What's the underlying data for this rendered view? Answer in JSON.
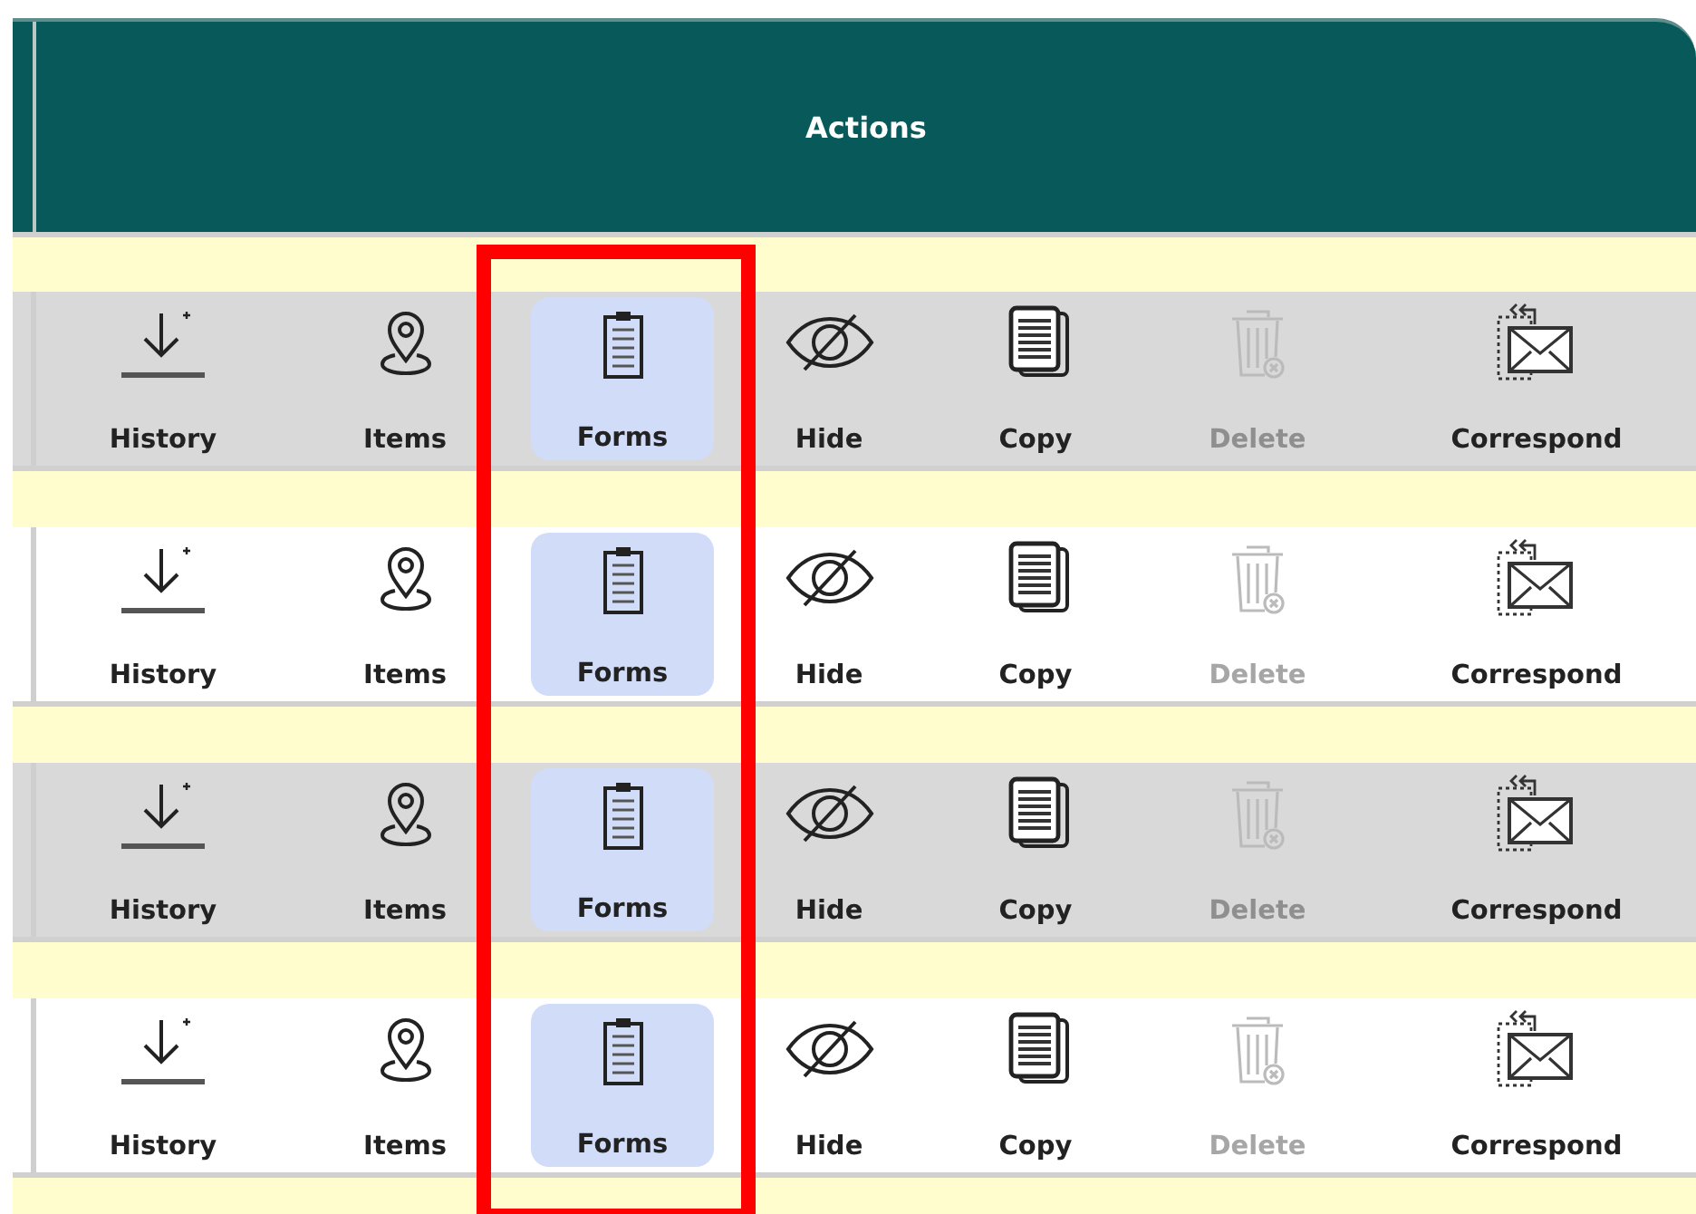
{
  "table": {
    "header": {
      "title": "Actions"
    },
    "rows": [
      {
        "shaded": true,
        "actions": [
          {
            "kind": "history",
            "label": "History",
            "disabled": false,
            "highlighted": false
          },
          {
            "kind": "items",
            "label": "Items",
            "disabled": false,
            "highlighted": false
          },
          {
            "kind": "forms",
            "label": "Forms",
            "disabled": false,
            "highlighted": true
          },
          {
            "kind": "hide",
            "label": "Hide",
            "disabled": false,
            "highlighted": false
          },
          {
            "kind": "copy",
            "label": "Copy",
            "disabled": false,
            "highlighted": false
          },
          {
            "kind": "delete",
            "label": "Delete",
            "disabled": true,
            "highlighted": false
          },
          {
            "kind": "correspond",
            "label": "Correspond",
            "disabled": false,
            "highlighted": false
          }
        ]
      },
      {
        "shaded": false,
        "actions": [
          {
            "kind": "history",
            "label": "History",
            "disabled": false,
            "highlighted": false
          },
          {
            "kind": "items",
            "label": "Items",
            "disabled": false,
            "highlighted": false
          },
          {
            "kind": "forms",
            "label": "Forms",
            "disabled": false,
            "highlighted": true
          },
          {
            "kind": "hide",
            "label": "Hide",
            "disabled": false,
            "highlighted": false
          },
          {
            "kind": "copy",
            "label": "Copy",
            "disabled": false,
            "highlighted": false
          },
          {
            "kind": "delete",
            "label": "Delete",
            "disabled": true,
            "highlighted": false
          },
          {
            "kind": "correspond",
            "label": "Correspond",
            "disabled": false,
            "highlighted": false
          }
        ]
      },
      {
        "shaded": true,
        "actions": [
          {
            "kind": "history",
            "label": "History",
            "disabled": false,
            "highlighted": false
          },
          {
            "kind": "items",
            "label": "Items",
            "disabled": false,
            "highlighted": false
          },
          {
            "kind": "forms",
            "label": "Forms",
            "disabled": false,
            "highlighted": true
          },
          {
            "kind": "hide",
            "label": "Hide",
            "disabled": false,
            "highlighted": false
          },
          {
            "kind": "copy",
            "label": "Copy",
            "disabled": false,
            "highlighted": false
          },
          {
            "kind": "delete",
            "label": "Delete",
            "disabled": true,
            "highlighted": false
          },
          {
            "kind": "correspond",
            "label": "Correspond",
            "disabled": false,
            "highlighted": false
          }
        ]
      },
      {
        "shaded": false,
        "actions": [
          {
            "kind": "history",
            "label": "History",
            "disabled": false,
            "highlighted": false
          },
          {
            "kind": "items",
            "label": "Items",
            "disabled": false,
            "highlighted": false
          },
          {
            "kind": "forms",
            "label": "Forms",
            "disabled": false,
            "highlighted": true
          },
          {
            "kind": "hide",
            "label": "Hide",
            "disabled": false,
            "highlighted": false
          },
          {
            "kind": "copy",
            "label": "Copy",
            "disabled": false,
            "highlighted": false
          },
          {
            "kind": "delete",
            "label": "Delete",
            "disabled": true,
            "highlighted": false
          },
          {
            "kind": "correspond",
            "label": "Correspond",
            "disabled": false,
            "highlighted": false
          }
        ]
      }
    ]
  },
  "annotation": {
    "kind": "frame"
  }
}
